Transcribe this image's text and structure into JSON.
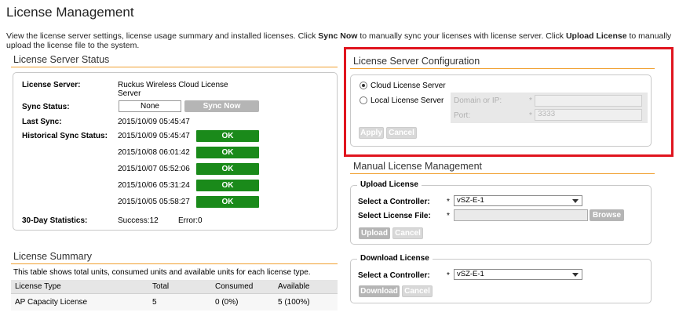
{
  "page": {
    "title": "License Management",
    "description_1": "View the license server settings, license usage summary and installed licenses. Click ",
    "sync_now_bold": "Sync Now",
    "description_2": " to manually sync your licenses with license server. Click ",
    "upload_license_bold": "Upload License",
    "description_3": " to manually upload the license file to the system."
  },
  "status": {
    "title": "License Server Status",
    "server_label": "License Server:",
    "server_value_line1": "Ruckus Wireless Cloud License",
    "server_value_line2": "Server",
    "sync_status_label": "Sync Status:",
    "sync_status_value": "None",
    "sync_now_button": "Sync Now",
    "last_sync_label": "Last Sync:",
    "last_sync_value": "2015/10/09 05:45:47",
    "historical_label": "Historical Sync Status:",
    "history": [
      {
        "time": "2015/10/09 05:45:47",
        "result": "OK"
      },
      {
        "time": "2015/10/08 06:01:42",
        "result": "OK"
      },
      {
        "time": "2015/10/07 05:52:06",
        "result": "OK"
      },
      {
        "time": "2015/10/06 05:31:24",
        "result": "OK"
      },
      {
        "time": "2015/10/05 05:58:27",
        "result": "OK"
      }
    ],
    "stats_label": "30-Day Statistics:",
    "stats_success": "Success:12",
    "stats_error": "Error:0"
  },
  "summary": {
    "title": "License Summary",
    "description": "This table shows total units, consumed units and available units for each license type.",
    "columns": [
      "License Type",
      "Total",
      "Consumed",
      "Available"
    ],
    "rows": [
      [
        "AP Capacity License",
        "5",
        "0 (0%)",
        "5 (100%)"
      ]
    ]
  },
  "config": {
    "title": "License Server Configuration",
    "cloud_option": "Cloud License Server",
    "local_option": "Local License Server",
    "cloud_selected": true,
    "domain_label": "Domain or IP:",
    "port_label": "Port:",
    "port_value": "3333",
    "required_mark": "*",
    "apply_button": "Apply",
    "cancel_button": "Cancel"
  },
  "manual": {
    "title": "Manual License Management",
    "upload": {
      "title": "Upload License",
      "controller_label": "Select a Controller:",
      "controller_value": "vSZ-E-1",
      "file_label": "Select License File:",
      "browse_button": "Browse",
      "upload_button": "Upload",
      "cancel_button": "Cancel",
      "required_mark": "*"
    },
    "download": {
      "title": "Download License",
      "controller_label": "Select a Controller:",
      "controller_value": "vSZ-E-1",
      "download_button": "Download",
      "cancel_button": "Cancel",
      "required_mark": "*"
    }
  },
  "colors": {
    "ok_green": "#1a8a1a",
    "section_rule": "#f0a030",
    "highlight_red": "#e0141e"
  }
}
